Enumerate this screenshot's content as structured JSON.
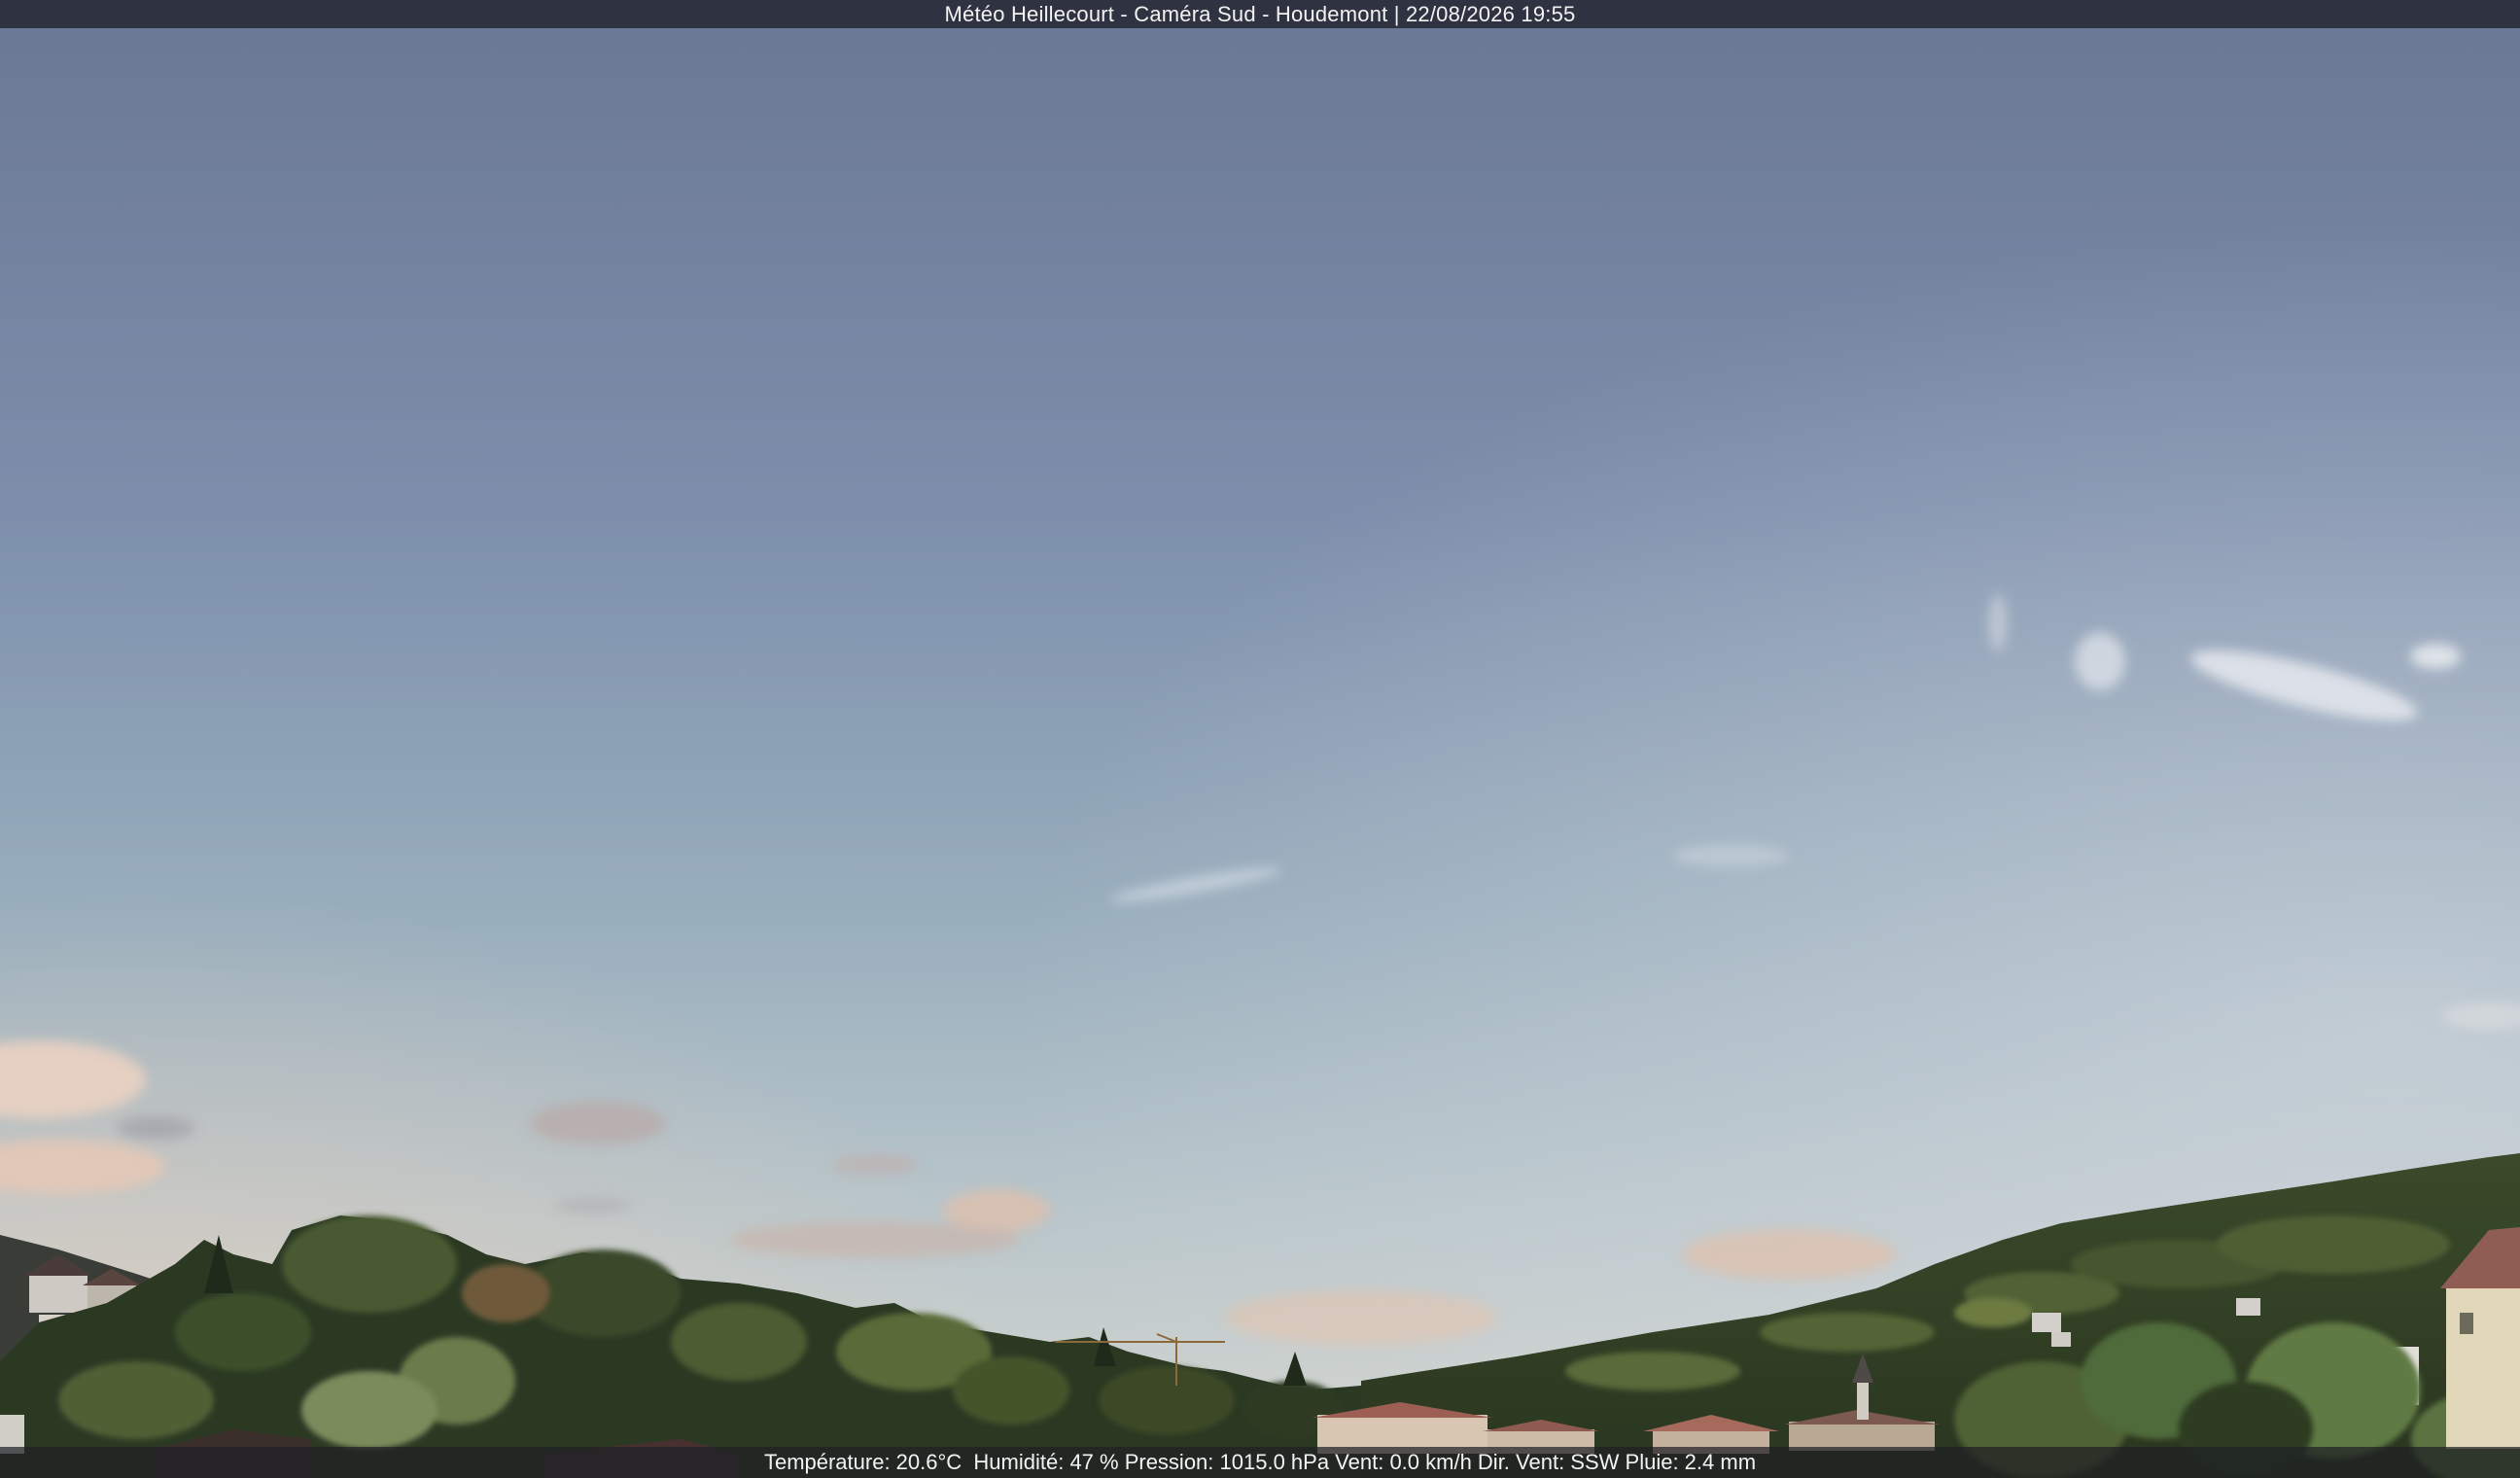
{
  "header": {
    "title": "Météo Heillecourt - Caméra Sud - Houdemont | 22/08/2026 19:55"
  },
  "footer": {
    "stats": "Température: 20.6°C  Humidité: 47 % Pression: 1015.0 hPa Vent: 0.0 km/h Dir. Vent: SSW Pluie: 2.4 mm"
  },
  "colors": {
    "sky_top": "#6b7895",
    "sky_mid": "#8ea2b8",
    "sky_horizon": "#c9d0d2",
    "forest_dark": "#23301f",
    "forest_mid": "#3f4f2d",
    "forest_light": "#677b45",
    "cloud_pink": "#e4c2b4",
    "roof_red": "#a8665a"
  }
}
